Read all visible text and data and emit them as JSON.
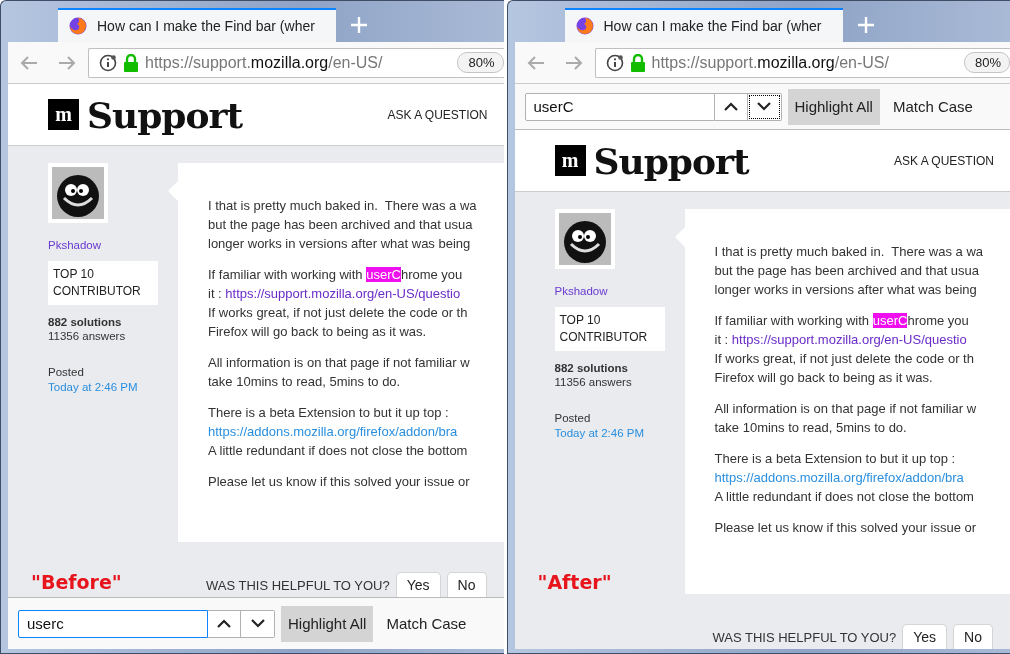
{
  "windows": [
    {
      "kind": "findbar_bottom",
      "caption": "\"Before\"",
      "tab": {
        "title": "How can I make the Find bar (wher"
      },
      "address": {
        "scheme": "https://support.",
        "domain": "mozilla.org",
        "path": "/en-US/"
      },
      "zoom": "80%",
      "findbar": {
        "query": "userc",
        "field_focused": true,
        "next_focused": false,
        "toggles": [
          {
            "label": "Highlight All",
            "selected": true
          },
          {
            "label": "Match Case",
            "selected": false
          }
        ]
      },
      "site": {
        "logo_mark": "m",
        "logo_text": "Support",
        "nav_link": "ASK A QUESTION"
      },
      "author": {
        "name": "Pkshadow",
        "badge": "TOP 10 CONTRIBUTOR",
        "solutions": "882 solutions",
        "answers": "11356 answers",
        "posted_label": "Posted",
        "posted_time": "Today at 2:46 PM"
      },
      "paragraphs": [
        [
          [
            {
              "kind": "plain",
              "text": "I that is pretty much baked in.  There was a wa"
            }
          ],
          [
            {
              "kind": "plain",
              "text": "but the page has been archived and that usua"
            }
          ],
          [
            {
              "kind": "plain",
              "text": "longer works in versions after what was being"
            }
          ]
        ],
        [
          [
            {
              "kind": "plain",
              "text": "If familiar with working with "
            },
            {
              "kind": "match",
              "text": "userC"
            },
            {
              "kind": "plain",
              "text": "hrome you"
            }
          ],
          [
            {
              "kind": "plain",
              "text": "it : "
            },
            {
              "kind": "visited_link",
              "text": "https://support.mozilla.org/en-US/questio"
            }
          ],
          [
            {
              "kind": "plain",
              "text": "If works great, if not just delete the code or th"
            }
          ],
          [
            {
              "kind": "plain",
              "text": "Firefox will go back to being as it was."
            }
          ]
        ],
        [
          [
            {
              "kind": "plain",
              "text": "All information is on that page if not familiar w"
            }
          ],
          [
            {
              "kind": "plain",
              "text": "take 10mins to read, 5mins to do."
            }
          ]
        ],
        [
          [
            {
              "kind": "plain",
              "text": "There is a beta Extension to but it up top :"
            }
          ],
          [
            {
              "kind": "link",
              "text": "https://addons.mozilla.org/firefox/addon/bra"
            }
          ],
          [
            {
              "kind": "plain",
              "text": "A little redundant if does not close the bottom"
            }
          ]
        ],
        [
          [
            {
              "kind": "plain",
              "text": "Please let us know if this solved your issue or"
            }
          ]
        ]
      ],
      "feedback": {
        "question": "WAS THIS HELPFUL TO YOU?",
        "buttons": [
          "Yes",
          "No"
        ]
      }
    },
    {
      "kind": "findbar_top",
      "caption": "\"After\"",
      "tab": {
        "title": "How can I make the Find bar (wher"
      },
      "address": {
        "scheme": "https://support.",
        "domain": "mozilla.org",
        "path": "/en-US/"
      },
      "zoom": "80%",
      "findbar": {
        "query": "userC",
        "field_focused": false,
        "next_focused": true,
        "toggles": [
          {
            "label": "Highlight All",
            "selected": true
          },
          {
            "label": "Match Case",
            "selected": false
          }
        ]
      },
      "site": {
        "logo_mark": "m",
        "logo_text": "Support",
        "nav_link": "ASK A QUESTION"
      },
      "author": {
        "name": "Pkshadow",
        "badge": "TOP 10 CONTRIBUTOR",
        "solutions": "882 solutions",
        "answers": "11356 answers",
        "posted_label": "Posted",
        "posted_time": "Today at 2:46 PM"
      },
      "paragraphs": [
        [
          [
            {
              "kind": "plain",
              "text": "I that is pretty much baked in.  There was a wa"
            }
          ],
          [
            {
              "kind": "plain",
              "text": "but the page has been archived and that usua"
            }
          ],
          [
            {
              "kind": "plain",
              "text": "longer works in versions after what was being"
            }
          ]
        ],
        [
          [
            {
              "kind": "plain",
              "text": "If familiar with working with "
            },
            {
              "kind": "match",
              "text": "userC"
            },
            {
              "kind": "plain",
              "text": "hrome you"
            }
          ],
          [
            {
              "kind": "plain",
              "text": "it : "
            },
            {
              "kind": "visited_link",
              "text": "https://support.mozilla.org/en-US/questio"
            }
          ],
          [
            {
              "kind": "plain",
              "text": "If works great, if not just delete the code or th"
            }
          ],
          [
            {
              "kind": "plain",
              "text": "Firefox will go back to being as it was."
            }
          ]
        ],
        [
          [
            {
              "kind": "plain",
              "text": "All information is on that page if not familiar w"
            }
          ],
          [
            {
              "kind": "plain",
              "text": "take 10mins to read, 5mins to do."
            }
          ]
        ],
        [
          [
            {
              "kind": "plain",
              "text": "There is a beta Extension to but it up top :"
            }
          ],
          [
            {
              "kind": "link",
              "text": "https://addons.mozilla.org/firefox/addon/bra"
            }
          ],
          [
            {
              "kind": "plain",
              "text": "A little redundant if does not close the bottom"
            }
          ]
        ],
        [
          [
            {
              "kind": "plain",
              "text": "Please let us know if this solved your issue or"
            }
          ]
        ]
      ],
      "feedback": {
        "question": "WAS THIS HELPFUL TO YOU?",
        "buttons": [
          "Yes",
          "No"
        ]
      }
    }
  ]
}
